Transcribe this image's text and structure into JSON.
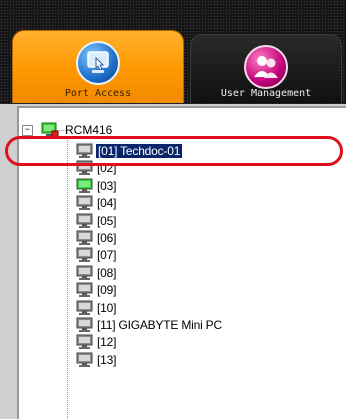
{
  "tabs": [
    {
      "label": "Port Access",
      "icon": "port-access-icon",
      "active": true
    },
    {
      "label": "User Management",
      "icon": "user-management-icon",
      "active": false
    }
  ],
  "tree": {
    "root": {
      "label": "RCM416",
      "expand_symbol": "−"
    },
    "ports": [
      {
        "label": "[01] Techdoc-01",
        "status": "gray",
        "selected": true
      },
      {
        "label": "[02]",
        "status": "gray",
        "selected": false
      },
      {
        "label": "[03]",
        "status": "green",
        "selected": false
      },
      {
        "label": "[04]",
        "status": "gray",
        "selected": false
      },
      {
        "label": "[05]",
        "status": "gray",
        "selected": false
      },
      {
        "label": "[06]",
        "status": "gray",
        "selected": false
      },
      {
        "label": "[07]",
        "status": "gray",
        "selected": false
      },
      {
        "label": "[08]",
        "status": "gray",
        "selected": false
      },
      {
        "label": "[09]",
        "status": "gray",
        "selected": false
      },
      {
        "label": "[10]",
        "status": "gray",
        "selected": false
      },
      {
        "label": "[11] GIGABYTE Mini PC",
        "status": "gray",
        "selected": false
      },
      {
        "label": "[12]",
        "status": "gray",
        "selected": false
      },
      {
        "label": "[13]",
        "status": "gray",
        "selected": false
      }
    ]
  },
  "colors": {
    "active_tab": "#ff9800",
    "selection": "#0a246a",
    "highlight_ring": "#e0101a",
    "online_green": "#33cc33"
  }
}
